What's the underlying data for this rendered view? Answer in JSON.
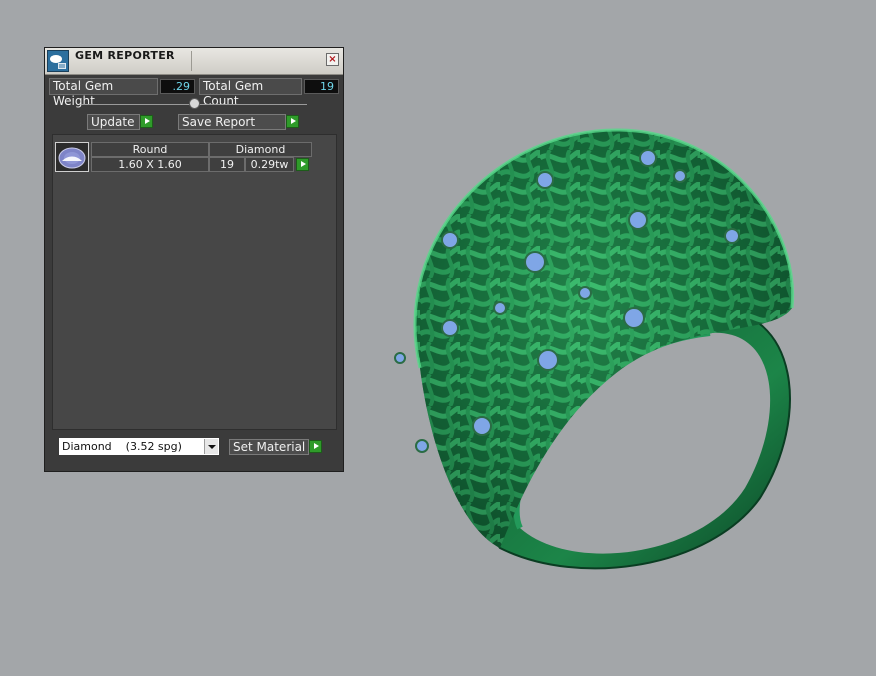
{
  "window": {
    "title": "GEM REPORTER",
    "close_glyph": "×"
  },
  "stats": {
    "weight_label": "Total Gem Weight",
    "weight_value": ".29",
    "count_label": "Total Gem Count",
    "count_value": "19"
  },
  "buttons": {
    "update_label": "Update",
    "save_label": "Save Report",
    "set_material_label": "Set Material"
  },
  "gem_table": {
    "headers": [
      "Round",
      "Diamond"
    ],
    "rows": [
      {
        "size": "1.60 X 1.60",
        "count": "19",
        "weight": "0.29tw"
      }
    ]
  },
  "material_select": {
    "value": "Diamond    (3.52 spg)"
  },
  "icons": {
    "app": "gem-reporter-icon",
    "gem": "round-gem-icon",
    "close": "close-icon",
    "arrow": "green-play-icon",
    "dropdown": "chevron-down-icon"
  },
  "colors": {
    "viewport_bg": "#a3a6a9",
    "ring_green": "#1f8a4c",
    "gem_blue": "#7fa6e6",
    "action_green": "#2f9b2a",
    "value_text": "#6fd6ea"
  }
}
